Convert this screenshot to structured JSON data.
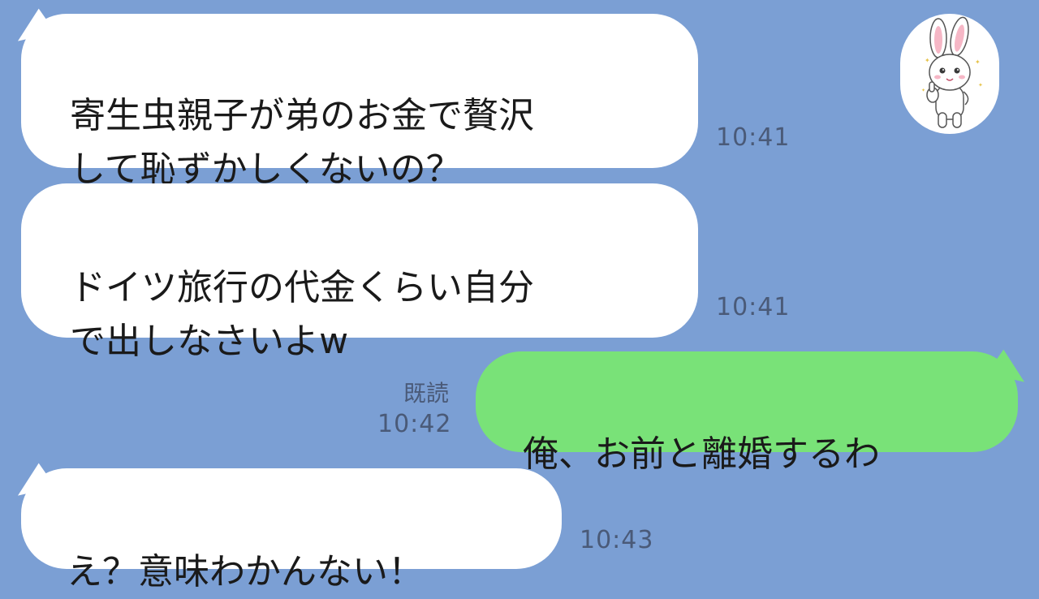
{
  "messages": [
    {
      "id": "m1",
      "side": "in",
      "text": "寄生虫親子が弟のお金で贅沢\nして恥ずかしくないの？",
      "time": "10:41"
    },
    {
      "id": "m2",
      "side": "in",
      "text": "ドイツ旅行の代金くらい自分\nで出しなさいよw",
      "time": "10:41"
    },
    {
      "id": "m3",
      "side": "out",
      "text": "俺、お前と離婚するわ",
      "time": "10:42",
      "read_label": "既読"
    },
    {
      "id": "m4",
      "side": "in",
      "text": "え？意味わかんない！",
      "time": "10:43"
    }
  ],
  "avatar": {
    "icon": "rabbit-thumbs-up-icon"
  },
  "colors": {
    "background": "#7b9fd4",
    "incoming_bubble": "#ffffff",
    "outgoing_bubble": "#79e278",
    "meta_text": "#4a5a78"
  }
}
